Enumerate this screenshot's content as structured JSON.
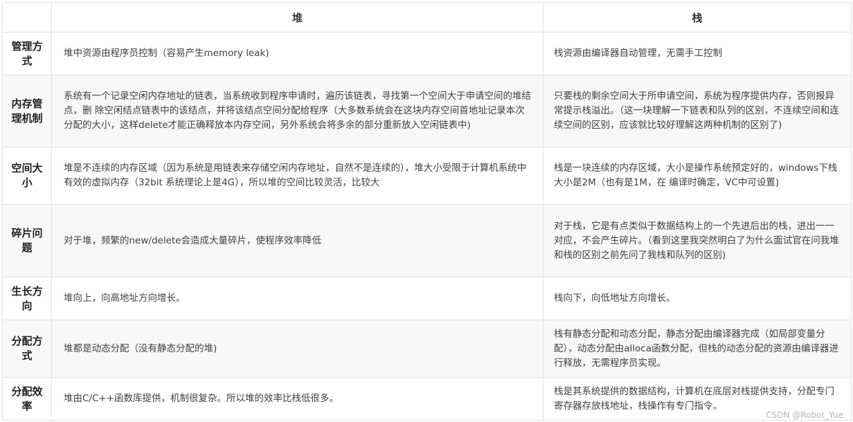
{
  "headers": [
    "",
    "堆",
    "栈"
  ],
  "rows": [
    {
      "label": "管理方式",
      "heap": "堆中资源由程序员控制（容易产生memory leak)",
      "stack": "栈资源由编译器自动管理，无需手工控制"
    },
    {
      "label": "内存管理机制",
      "heap": "系统有一个记录空闲内存地址的链表，当系统收到程序申请时，遍历该链表，寻找第一个空间大于申请空间的堆结点，删 除空闲结点链表中的该结点，并将该结点空间分配给程序（大多数系统会在这块内存空间首地址记录本次分配的大小，这样delete才能正确释放本内存空间，另外系统会将多余的部分重新放入空闲链表中)",
      "stack": "只要栈的剩余空间大于所申请空间，系统为程序提供内存，否则报异常提示栈溢出。（这一块理解一下链表和队列的区别，不连续空间和连续空间的区别，应该就比较好理解这两种机制的区别了)"
    },
    {
      "label": "空间大小",
      "heap": "堆是不连续的内存区域（因为系统是用链表来存储空闲内存地址，自然不是连续的），堆大小受限于计算机系统中有效的虚拟内存（32bit 系统理论上是4G），所以堆的空间比较灵活，比较大",
      "stack": "栈是一块连续的内存区域，大小是操作系统预定好的，windows下栈大小是2M（也有是1M，在 编译时确定，VC中可设置)"
    },
    {
      "label": "碎片问题",
      "heap": "对于堆，频繁的new/delete会造成大量碎片，使程序效率降低",
      "stack": "对于栈，它是有点类似于数据结构上的一个先进后出的栈，进出一一对应，不会产生碎片。（看到这里我突然明白了为什么面试官在问我堆和栈的区别之前先问了我栈和队列的区别)"
    },
    {
      "label": "生长方向",
      "heap": "堆向上，向高地址方向增长。",
      "stack": "栈向下，向低地址方向增长。"
    },
    {
      "label": "分配方式",
      "heap": "堆都是动态分配（没有静态分配的堆)",
      "stack": "栈有静态分配和动态分配，静态分配由编译器完成（如局部变量分配），动态分配由alloca函数分配，但栈的动态分配的资源由编译器进行释放，无需程序员实现。"
    },
    {
      "label": "分配效率",
      "heap": "堆由C/C++函数库提供，机制很复杂。所以堆的效率比栈低很多。",
      "stack": "栈是其系统提供的数据结构，计算机在底层对栈提供支持，分配专门 寄存器存放栈地址，栈操作有专门指令。"
    }
  ],
  "watermark": "CSDN @Robot_Yue"
}
